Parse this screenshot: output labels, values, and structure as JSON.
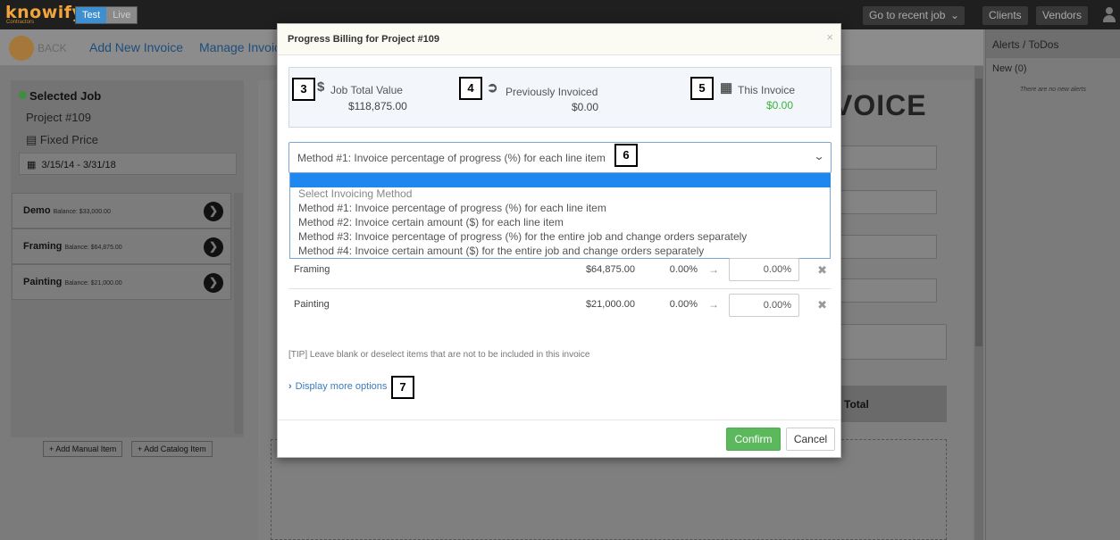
{
  "topbar": {
    "logo": "knowify",
    "logo_sub": "Contractors",
    "env_test": "Test",
    "env_live": "Live",
    "recent_job": "Go to recent job",
    "clients": "Clients",
    "vendors": "Vendors"
  },
  "subnav": {
    "back": "BACK",
    "add_invoice": "Add New Invoice",
    "manage_invoices": "Manage Invoices"
  },
  "left": {
    "selected_job": "Selected Job",
    "project": "Project #109",
    "contract_type": "Fixed Price",
    "date_range": "3/15/14 - 3/31/18",
    "items": [
      {
        "name": "Demo",
        "balance": "Balance: $33,000.00"
      },
      {
        "name": "Framing",
        "balance": "Balance: $64,875.00"
      },
      {
        "name": "Painting",
        "balance": "Balance: $21,000.00"
      }
    ],
    "add_manual": "+ Add Manual Item",
    "add_catalog": "+ Add Catalog Item"
  },
  "background": {
    "invoice_heading": "VOICE",
    "total_label": "Total"
  },
  "alerts": {
    "title": "Alerts / ToDos",
    "new_label": "New (0)",
    "empty": "There are no new alerts"
  },
  "modal": {
    "title": "Progress Billing for Project #109",
    "close": "×",
    "summary": {
      "job_total_label": "Job Total Value",
      "job_total_value": "$118,875.00",
      "prev_label": "Previously Invoiced",
      "prev_value": "$0.00",
      "this_label": "This Invoice",
      "this_value": "$0.00"
    },
    "method_selected": "Method #1: Invoice percentage of progress (%) for each line item",
    "options": [
      "Select Invoicing Method",
      "Method #1: Invoice percentage of progress (%) for each line item",
      "Method #2: Invoice certain amount ($) for each line item",
      "Method #3: Invoice percentage of progress (%) for the entire job and change orders separately",
      "Method #4: Invoice certain amount ($) for the entire job and change orders separately"
    ],
    "rows": [
      {
        "name": "Framing",
        "amount": "$64,875.00",
        "pct": "0.00%",
        "input": "0.00%"
      },
      {
        "name": "Painting",
        "amount": "$21,000.00",
        "pct": "0.00%",
        "input": "0.00%"
      }
    ],
    "tip": "[TIP] Leave blank or deselect items that are not to be included in this invoice",
    "more_options": "Display more options",
    "confirm": "Confirm",
    "cancel": "Cancel"
  },
  "callouts": [
    "3",
    "4",
    "5",
    "6",
    "7"
  ],
  "colors": {
    "accent": "#3b7bbf",
    "confirm": "#5cb85c",
    "value_green": "#3cb33c",
    "highlight": "#1e88f0"
  }
}
